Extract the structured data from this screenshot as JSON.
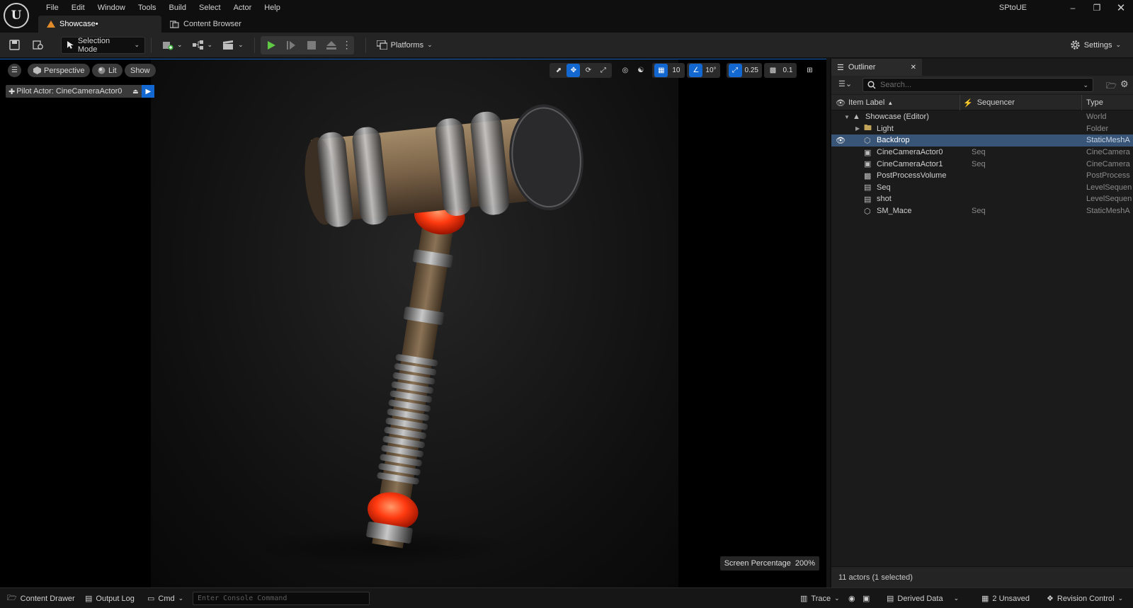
{
  "app": {
    "window_title": "SPtoUE",
    "menu": [
      "File",
      "Edit",
      "Window",
      "Tools",
      "Build",
      "Select",
      "Actor",
      "Help"
    ],
    "tabs": [
      {
        "label": "Showcase•",
        "active": true
      },
      {
        "label": "Content Browser",
        "active": false
      }
    ]
  },
  "toolbar": {
    "mode_label": "Selection Mode",
    "platforms_label": "Platforms",
    "settings_label": "Settings"
  },
  "viewport": {
    "perspective_label": "Perspective",
    "lit_label": "Lit",
    "show_label": "Show",
    "pilot_label": "Pilot Actor: CineCameraActor0",
    "grid_snap": "10",
    "rotation_snap": "10°",
    "scale_snap": "0.25",
    "camera_speed": "0.1",
    "screen_percentage_label": "Screen Percentage",
    "screen_percentage_value": "200%",
    "accent_color": "#1367d0"
  },
  "outliner": {
    "tab_label": "Outliner",
    "search_placeholder": "Search...",
    "columns": {
      "label": "Item Label",
      "sequencer": "Sequencer",
      "type": "Type"
    },
    "rows": [
      {
        "label": "Showcase (Editor)",
        "sequencer": "",
        "type": "World",
        "icon": "world-icon",
        "indent": 1,
        "expander": "open",
        "selected": false,
        "visible_eye": false
      },
      {
        "label": "Light",
        "sequencer": "",
        "type": "Folder",
        "icon": "folder-icon",
        "indent": 2,
        "expander": "closed",
        "selected": false,
        "visible_eye": false
      },
      {
        "label": "Backdrop",
        "sequencer": "",
        "type": "StaticMeshA",
        "icon": "static-mesh-icon",
        "indent": 2,
        "expander": "",
        "selected": true,
        "visible_eye": true
      },
      {
        "label": "CineCameraActor0",
        "sequencer": "Seq",
        "type": "CineCamera",
        "icon": "cine-camera-icon",
        "indent": 2,
        "expander": "",
        "selected": false,
        "visible_eye": false
      },
      {
        "label": "CineCameraActor1",
        "sequencer": "Seq",
        "type": "CineCamera",
        "icon": "cine-camera-icon",
        "indent": 2,
        "expander": "",
        "selected": false,
        "visible_eye": false
      },
      {
        "label": "PostProcessVolume",
        "sequencer": "",
        "type": "PostProcess",
        "icon": "post-process-icon",
        "indent": 2,
        "expander": "",
        "selected": false,
        "visible_eye": false
      },
      {
        "label": "Seq",
        "sequencer": "",
        "type": "LevelSequen",
        "icon": "level-sequence-icon",
        "indent": 2,
        "expander": "",
        "selected": false,
        "visible_eye": false
      },
      {
        "label": "shot",
        "sequencer": "",
        "type": "LevelSequen",
        "icon": "level-sequence-icon",
        "indent": 2,
        "expander": "",
        "selected": false,
        "visible_eye": false
      },
      {
        "label": "SM_Mace",
        "sequencer": "Seq",
        "type": "StaticMeshA",
        "icon": "static-mesh-icon",
        "indent": 2,
        "expander": "",
        "selected": false,
        "visible_eye": false
      }
    ],
    "footer": "11 actors (1 selected)"
  },
  "statusbar": {
    "content_drawer": "Content Drawer",
    "output_log": "Output Log",
    "cmd": "Cmd",
    "console_placeholder": "Enter Console Command",
    "trace": "Trace",
    "derived_data": "Derived Data",
    "unsaved": "2 Unsaved",
    "revision_control": "Revision Control"
  }
}
